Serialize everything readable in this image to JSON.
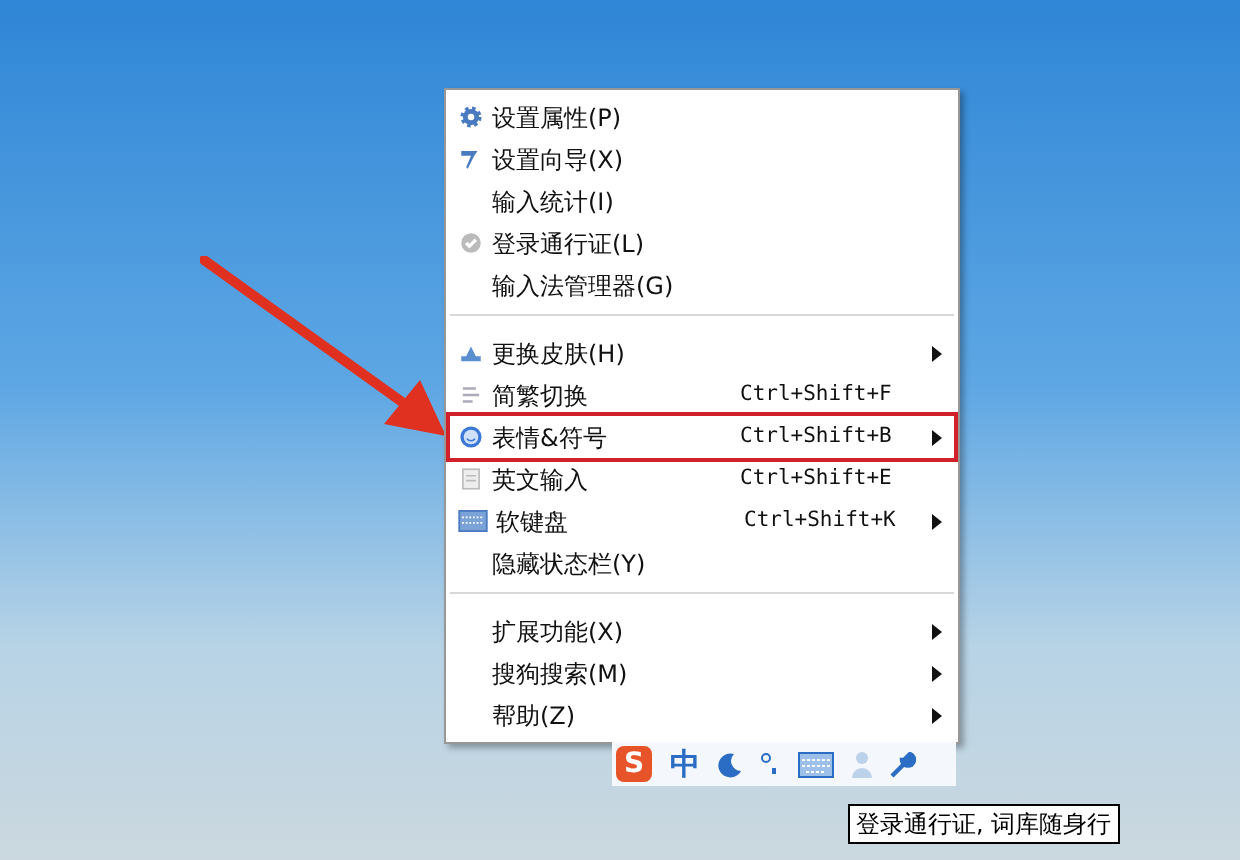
{
  "context_menu": {
    "groups": [
      {
        "items": [
          {
            "label": "设置属性(P)",
            "submenu": false,
            "highlighted": false
          },
          {
            "label": "设置向导(X)",
            "submenu": false,
            "highlighted": false
          },
          {
            "label": "输入统计(I)",
            "submenu": false,
            "highlighted": false
          },
          {
            "label": "登录通行证(L)",
            "submenu": false,
            "highlighted": false
          },
          {
            "label": "输入法管理器(G)",
            "submenu": false,
            "highlighted": false
          }
        ]
      },
      {
        "items": [
          {
            "label": "更换皮肤(H)",
            "submenu": true,
            "highlighted": false
          },
          {
            "label": "简繁切换",
            "shortcut": "Ctrl+Shift+F",
            "submenu": false,
            "highlighted": false
          },
          {
            "label": "表情&符号",
            "shortcut": "Ctrl+Shift+B",
            "submenu": true,
            "highlighted": true
          },
          {
            "label": "英文输入",
            "shortcut": "Ctrl+Shift+E",
            "submenu": false,
            "highlighted": false
          },
          {
            "label": "软键盘",
            "shortcut": "Ctrl+Shift+K",
            "submenu": true,
            "highlighted": false
          },
          {
            "label": "隐藏状态栏(Y)",
            "submenu": false,
            "highlighted": false
          }
        ]
      },
      {
        "items": [
          {
            "label": "扩展功能(X)",
            "submenu": true,
            "highlighted": false
          },
          {
            "label": "搜狗搜索(M)",
            "submenu": true,
            "highlighted": false
          },
          {
            "label": "帮助(Z)",
            "submenu": true,
            "highlighted": false
          }
        ]
      }
    ]
  },
  "status_bar": {
    "logo_letter": "S",
    "mode": "中"
  },
  "tooltip": "登录通行证, 词库随身行"
}
